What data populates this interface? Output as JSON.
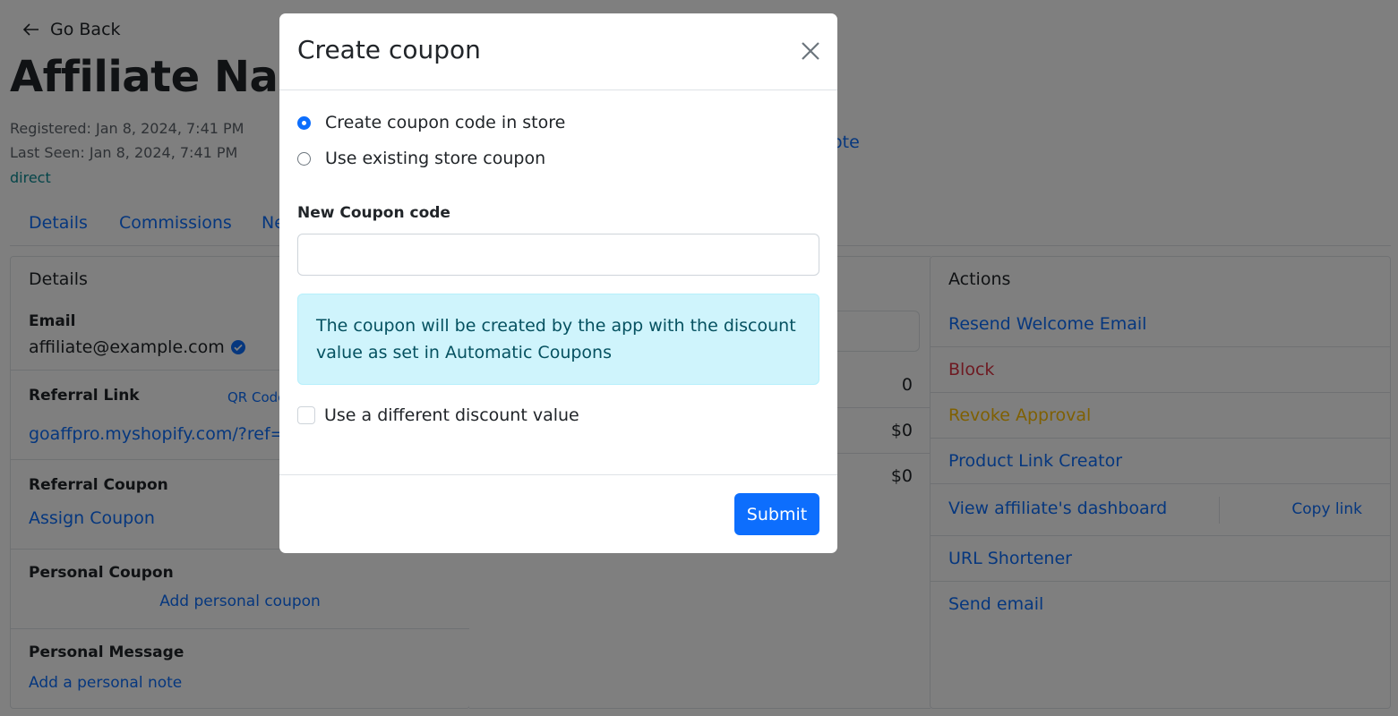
{
  "page": {
    "back_label": "Go Back",
    "title": "Affiliate Nam",
    "registered": "Registered: Jan 8, 2024, 7:41 PM",
    "last_seen": "Last Seen: Jan 8, 2024, 7:41 PM",
    "source": "direct",
    "note_fragment": "ote",
    "tabs": [
      "Details",
      "Commissions",
      "Ne"
    ]
  },
  "details": {
    "heading": "Details",
    "email_label": "Email",
    "email_value": "affiliate@example.com",
    "referral_link_label": "Referral Link",
    "qr_code": "QR Code",
    "referral_link_value": "goaffpro.myshopify.com/?ref=y",
    "referral_coupon_label": "Referral Coupon",
    "assign_coupon": "Assign Coupon",
    "personal_coupon_label": "Personal Coupon",
    "add_personal_coupon": "Add personal coupon",
    "personal_message_label": "Personal Message",
    "add_personal_note": "Add a personal note"
  },
  "stats": {
    "values": [
      "0",
      "$0",
      "$0"
    ]
  },
  "actions": {
    "heading": "Actions",
    "resend": "Resend Welcome Email",
    "block": "Block",
    "revoke": "Revoke Approval",
    "product_link": "Product Link Creator",
    "dashboard": "View affiliate's dashboard",
    "copy_link": "Copy link",
    "shortener": "URL Shortener",
    "send_email": "Send email",
    "colors": {
      "link": "#0d6efd",
      "block": "#dc3545",
      "revoke": "#ffc107"
    }
  },
  "modal": {
    "title": "Create coupon",
    "option_create": "Create coupon code in store",
    "option_existing": "Use existing store coupon",
    "selected_option": "create",
    "field_label": "New Coupon code",
    "field_value": "",
    "info_text": "The coupon will be created by the app with the discount value as set in Automatic Coupons",
    "checkbox_label": "Use a different discount value",
    "checkbox_checked": false,
    "submit": "Submit"
  }
}
